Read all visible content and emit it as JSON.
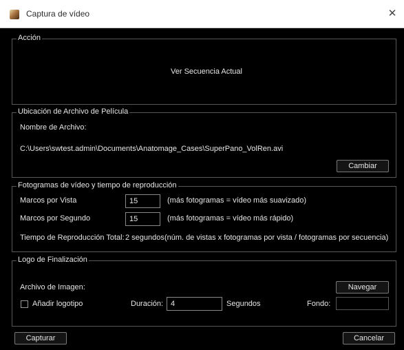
{
  "window": {
    "title": "Captura de vídeo",
    "close_glyph": "✕",
    "app_icon": "anatomage-app-icon"
  },
  "accion": {
    "legend": "Acción",
    "view_label": "Ver Secuencia Actual"
  },
  "ubicacion": {
    "legend": "Ubicación de Archivo de Película",
    "filename_label": "Nombre de Archivo:",
    "path": "C:\\Users\\swtest.admin\\Documents\\Anatomage_Cases\\SuperPano_VolRen.avi",
    "change_button": "Cambiar"
  },
  "fotogramas": {
    "legend": "Fotogramas de vídeo y tiempo de reproducción",
    "marcos_vista_label": "Marcos por Vista",
    "marcos_vista_value": "15",
    "marcos_vista_hint": "(más fotogramas = vídeo más suavizado)",
    "marcos_segundo_label": "Marcos por Segundo",
    "marcos_segundo_value": "15",
    "marcos_segundo_hint": "(más fotogramas = vídeo más rápido)",
    "tiempo_label": "Tiempo de Reproducción Total:",
    "tiempo_value": "2 segundos",
    "tiempo_hint": "(núm. de vistas x fotogramas por vista / fotogramas por secuencia)"
  },
  "logo": {
    "legend": "Logo de Finalización",
    "archivo_label": "Archivo de Imagen:",
    "navegar_button": "Navegar",
    "add_logo_label": "Añadir logotipo",
    "add_logo_checked": false,
    "duracion_label": "Duración:",
    "duracion_value": "4",
    "segundos_label": "Segundos",
    "fondo_label": "Fondo:",
    "fondo_value": ""
  },
  "footer": {
    "capturar_button": "Capturar",
    "cancelar_button": "Cancelar"
  }
}
